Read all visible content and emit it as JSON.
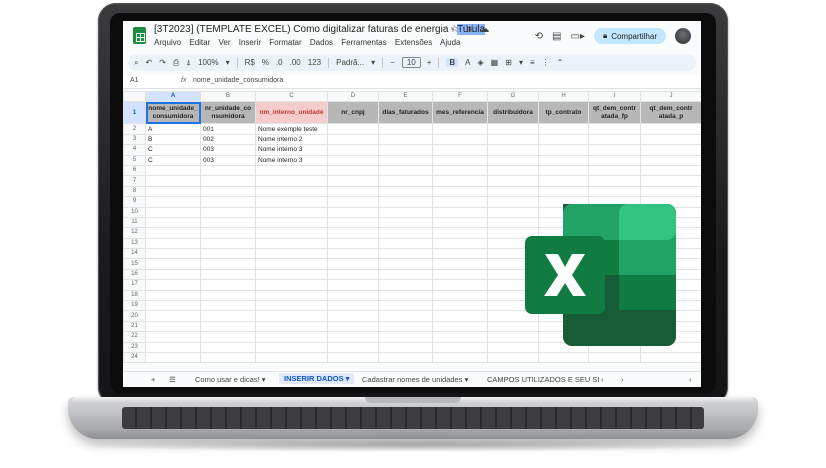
{
  "window": {
    "doc_title_main": "[3T2023] (TEMPLATE EXCEL) Como digitalizar faturas de energia - ",
    "doc_title_tail": "Turula",
    "share_label": "Compartilhar"
  },
  "menu": [
    "Arquivo",
    "Editar",
    "Ver",
    "Inserir",
    "Formatar",
    "Dados",
    "Ferramentas",
    "Extensões",
    "Ajuda"
  ],
  "toolbar": {
    "zoom": "100%",
    "currency": "R$",
    "percent": "%",
    "dec1": ".0",
    "dec2": ".00",
    "numfmt": "123",
    "font": "Padrã...",
    "font_size": "10",
    "bold": "B"
  },
  "formula_bar": {
    "cell_ref": "A1",
    "value": "nome_unidade_consumidora"
  },
  "columns": [
    "A",
    "B",
    "C",
    "D",
    "E",
    "F",
    "G",
    "H",
    "I",
    "J"
  ],
  "header_row": [
    "nome_unidade_consumidora",
    "nr_unidade_consumidora",
    "nm_interno_unidade",
    "nr_cnpj",
    "dias_faturados",
    "mes_referencia",
    "distribuidora",
    "tp_contrato",
    "qt_dem_contratada_fp",
    "qt_dem_contratada_p"
  ],
  "header_display": [
    "nome_unidade_ consumidora",
    "nr_unidade_co nsumidora",
    "nm_interno_unidade",
    "nr_cnpj",
    "dias_faturados",
    "mes_referencia",
    "distribuidora",
    "tp_contrato",
    "qt_dem_contr atada_fp",
    "qt_dem_contr atada_p"
  ],
  "data_rows": [
    [
      "A",
      "001",
      "Nome exemple teste"
    ],
    [
      "B",
      "002",
      "Nome interno 2"
    ],
    [
      "C",
      "003",
      "Nome interno 3"
    ],
    [
      "C",
      "003",
      "Nome interno 3"
    ]
  ],
  "row_numbers": [
    "1",
    "2",
    "3",
    "4",
    "5",
    "6",
    "7",
    "8",
    "9",
    "10",
    "11",
    "12",
    "13",
    "14",
    "15",
    "16",
    "17",
    "18",
    "19",
    "20",
    "21",
    "22",
    "23",
    "24"
  ],
  "sheet_tabs": [
    "Como usar e dicas!",
    "INSERIR DADOS",
    "Cadastrar nomes de unidades",
    "CAMPOS UTILIZADOS E SEU SI"
  ],
  "active_tab": "INSERIR DADOS",
  "colors": {
    "header_gray": "#b7b7b7",
    "header_pink": "#f4cccc",
    "excel_green_dark": "#185c37",
    "excel_green": "#21a366",
    "excel_green_light": "#33c481",
    "excel_x_tile": "#107c41"
  },
  "icons": [
    "add-sheet-icon",
    "sheets-list-icon",
    "undo-icon",
    "redo-icon",
    "print-icon",
    "paint-format-icon",
    "history-icon",
    "comment-icon",
    "video-call-icon",
    "star-icon",
    "move-icon",
    "cloud-icon",
    "excel-logo-icon"
  ]
}
